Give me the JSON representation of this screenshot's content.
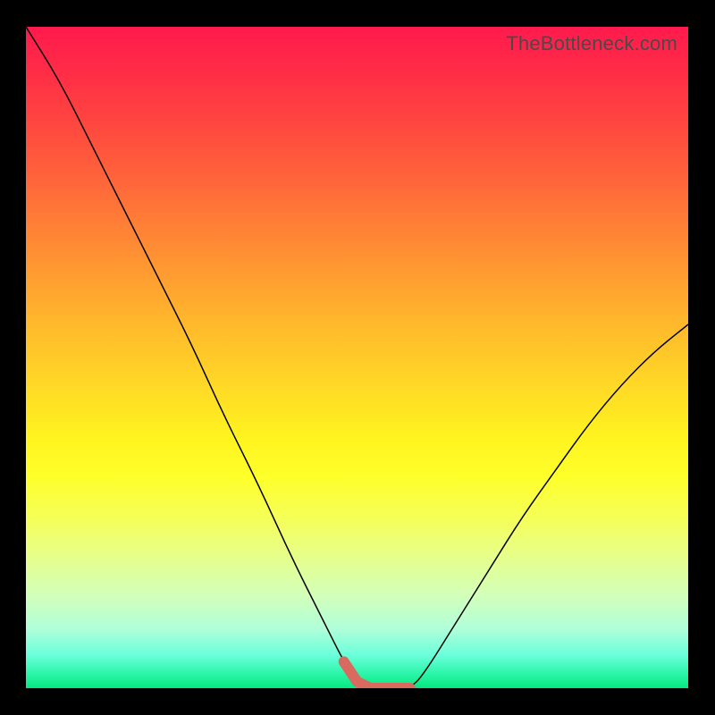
{
  "attribution": "TheBottleneck.com",
  "colors": {
    "frame": "#000000",
    "curve": "#000000",
    "highlight": "#d86a5f"
  },
  "chart_data": {
    "type": "line",
    "title": "",
    "xlabel": "",
    "ylabel": "",
    "xlim": [
      0,
      100
    ],
    "ylim": [
      0,
      100
    ],
    "x": [
      0,
      5,
      10,
      15,
      20,
      25,
      30,
      35,
      40,
      45,
      48,
      50,
      52,
      55,
      58,
      60,
      65,
      70,
      75,
      80,
      85,
      90,
      95,
      100
    ],
    "values": [
      100,
      92,
      82,
      72,
      62,
      52,
      41,
      31,
      20,
      10,
      4,
      1,
      0,
      0,
      0,
      2,
      10,
      18,
      26,
      33,
      40,
      46,
      51,
      55
    ],
    "highlight_range_x": [
      48,
      58
    ],
    "notes": "V-shaped bottleneck curve on a green-to-red vertical gradient. Minimum (optimal) region around x≈48–58 is emphasized with a thick salmon stroke near y≈0."
  }
}
